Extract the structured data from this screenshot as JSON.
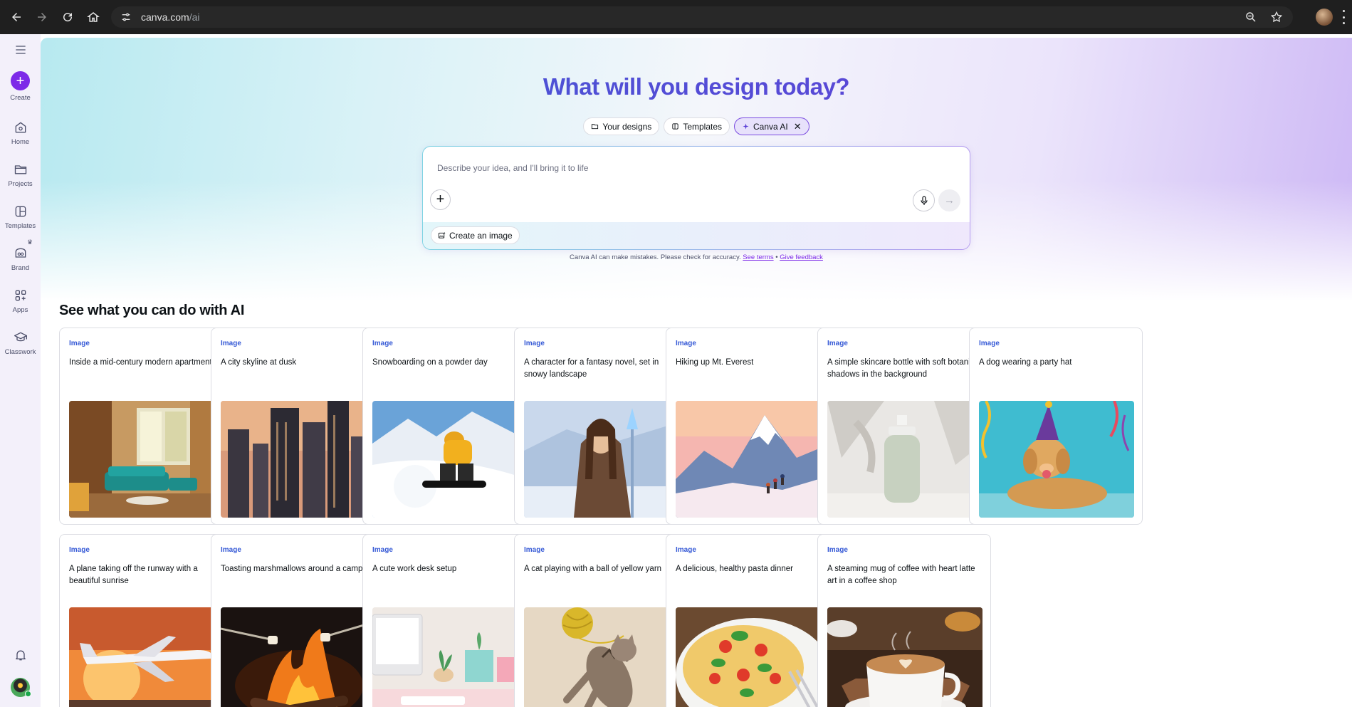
{
  "browser": {
    "url_host": "canva.com",
    "url_path": "/ai"
  },
  "sidebar": {
    "items": [
      {
        "label": "Create",
        "icon": "plus-icon"
      },
      {
        "label": "Home",
        "icon": "home-icon"
      },
      {
        "label": "Projects",
        "icon": "folder-icon"
      },
      {
        "label": "Templates",
        "icon": "templates-icon"
      },
      {
        "label": "Brand",
        "icon": "brand-icon"
      },
      {
        "label": "Apps",
        "icon": "apps-icon"
      },
      {
        "label": "Classwork",
        "icon": "graduation-cap-icon"
      }
    ]
  },
  "hero": {
    "title": "What will you design today?",
    "pills": [
      {
        "label": "Your designs",
        "icon": "folder-icon"
      },
      {
        "label": "Templates",
        "icon": "templates-icon"
      },
      {
        "label": "Canva AI",
        "icon": "sparkle-icon",
        "active": true
      }
    ],
    "prompt_placeholder": "Describe your idea, and I'll bring it to life",
    "create_image_label": "Create an image",
    "disclaimer_text": "Canva AI can make mistakes. Please check for accuracy.",
    "see_terms": "See terms",
    "separator": "•",
    "give_feedback": "Give feedback"
  },
  "section": {
    "title": "See what you can do with AI"
  },
  "cards": [
    {
      "tag": "Image",
      "desc": "Inside a mid-century modern apartment",
      "scene": "apartment"
    },
    {
      "tag": "Image",
      "desc": "A city skyline at dusk",
      "scene": "skyline"
    },
    {
      "tag": "Image",
      "desc": "Snowboarding on a powder day",
      "scene": "snowboard"
    },
    {
      "tag": "Image",
      "desc": "A character for a fantasy novel, set in snowy landscape",
      "scene": "fantasy"
    },
    {
      "tag": "Image",
      "desc": "Hiking up Mt. Everest",
      "scene": "everest"
    },
    {
      "tag": "Image",
      "desc": "A simple skincare bottle with soft botanical shadows in the background",
      "scene": "skincare"
    },
    {
      "tag": "Image",
      "desc": "A dog wearing a party hat",
      "scene": "dog"
    },
    {
      "tag": "Image",
      "desc": "A plane taking off the runway with a beautiful sunrise",
      "scene": "plane"
    },
    {
      "tag": "Image",
      "desc": "Toasting marshmallows around a campfire",
      "scene": "campfire"
    },
    {
      "tag": "Image",
      "desc": "A cute work desk setup",
      "scene": "desk"
    },
    {
      "tag": "Image",
      "desc": "A cat playing with a ball of yellow yarn",
      "scene": "cat"
    },
    {
      "tag": "Image",
      "desc": "A delicious, healthy pasta dinner",
      "scene": "pasta"
    },
    {
      "tag": "Image",
      "desc": "A steaming mug of coffee with heart latte art in a coffee shop",
      "scene": "coffee"
    }
  ],
  "colors": {
    "accent": "#7d2ae8",
    "tag_blue": "#3559d6"
  }
}
